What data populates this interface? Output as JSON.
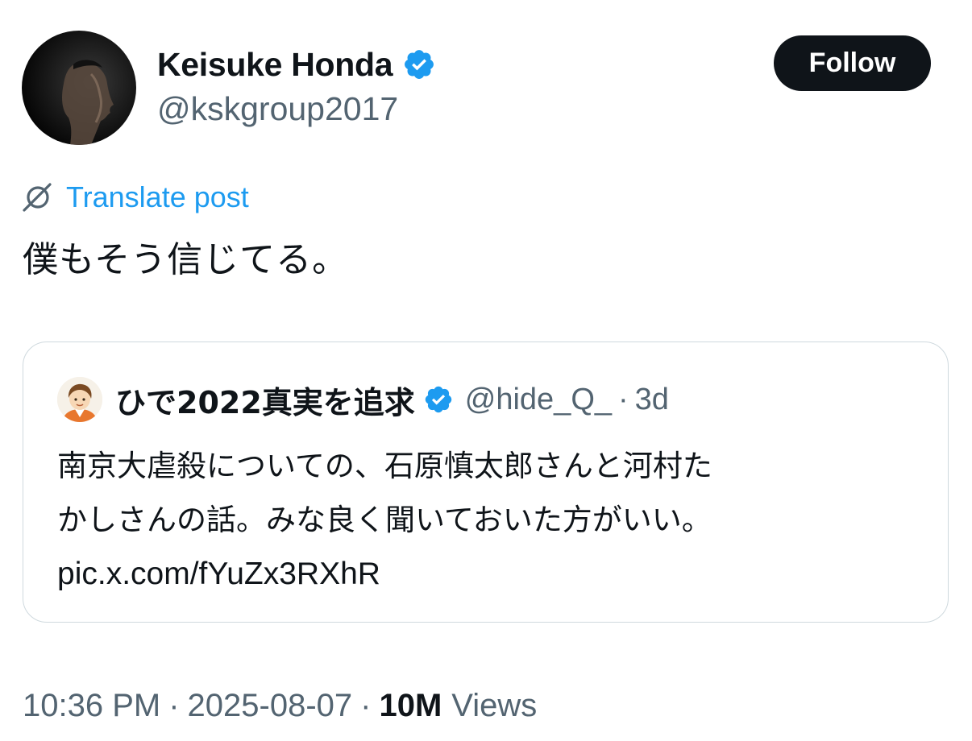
{
  "author": {
    "display_name": "Keisuke Honda",
    "handle": "@kskgroup2017",
    "verified": true,
    "avatar_icon": "profile-photo"
  },
  "follow_button": {
    "label": "Follow"
  },
  "translate": {
    "icon": "translate-icon",
    "label": "Translate post"
  },
  "post": {
    "text": "僕もそう信じてる。"
  },
  "quote": {
    "display_name": "ひで2022真実を追求",
    "verified": true,
    "handle": "@hide_Q_",
    "separator": "·",
    "time": "3d",
    "text_lines": [
      "南京大虐殺についての、石原慎太郎さんと河村た",
      "かしさんの話。みな良く聞いておいた方がいい。"
    ],
    "link": "pic.x.com/fYuZx3RXhR"
  },
  "meta": {
    "time": "10:36 PM",
    "separator": "·",
    "date": "2025-08-07",
    "views_count": "10M",
    "views_label": "Views"
  },
  "colors": {
    "accent": "#1d9bf0",
    "text": "#0f1419",
    "secondary": "#536471",
    "border": "#cfd9de"
  }
}
